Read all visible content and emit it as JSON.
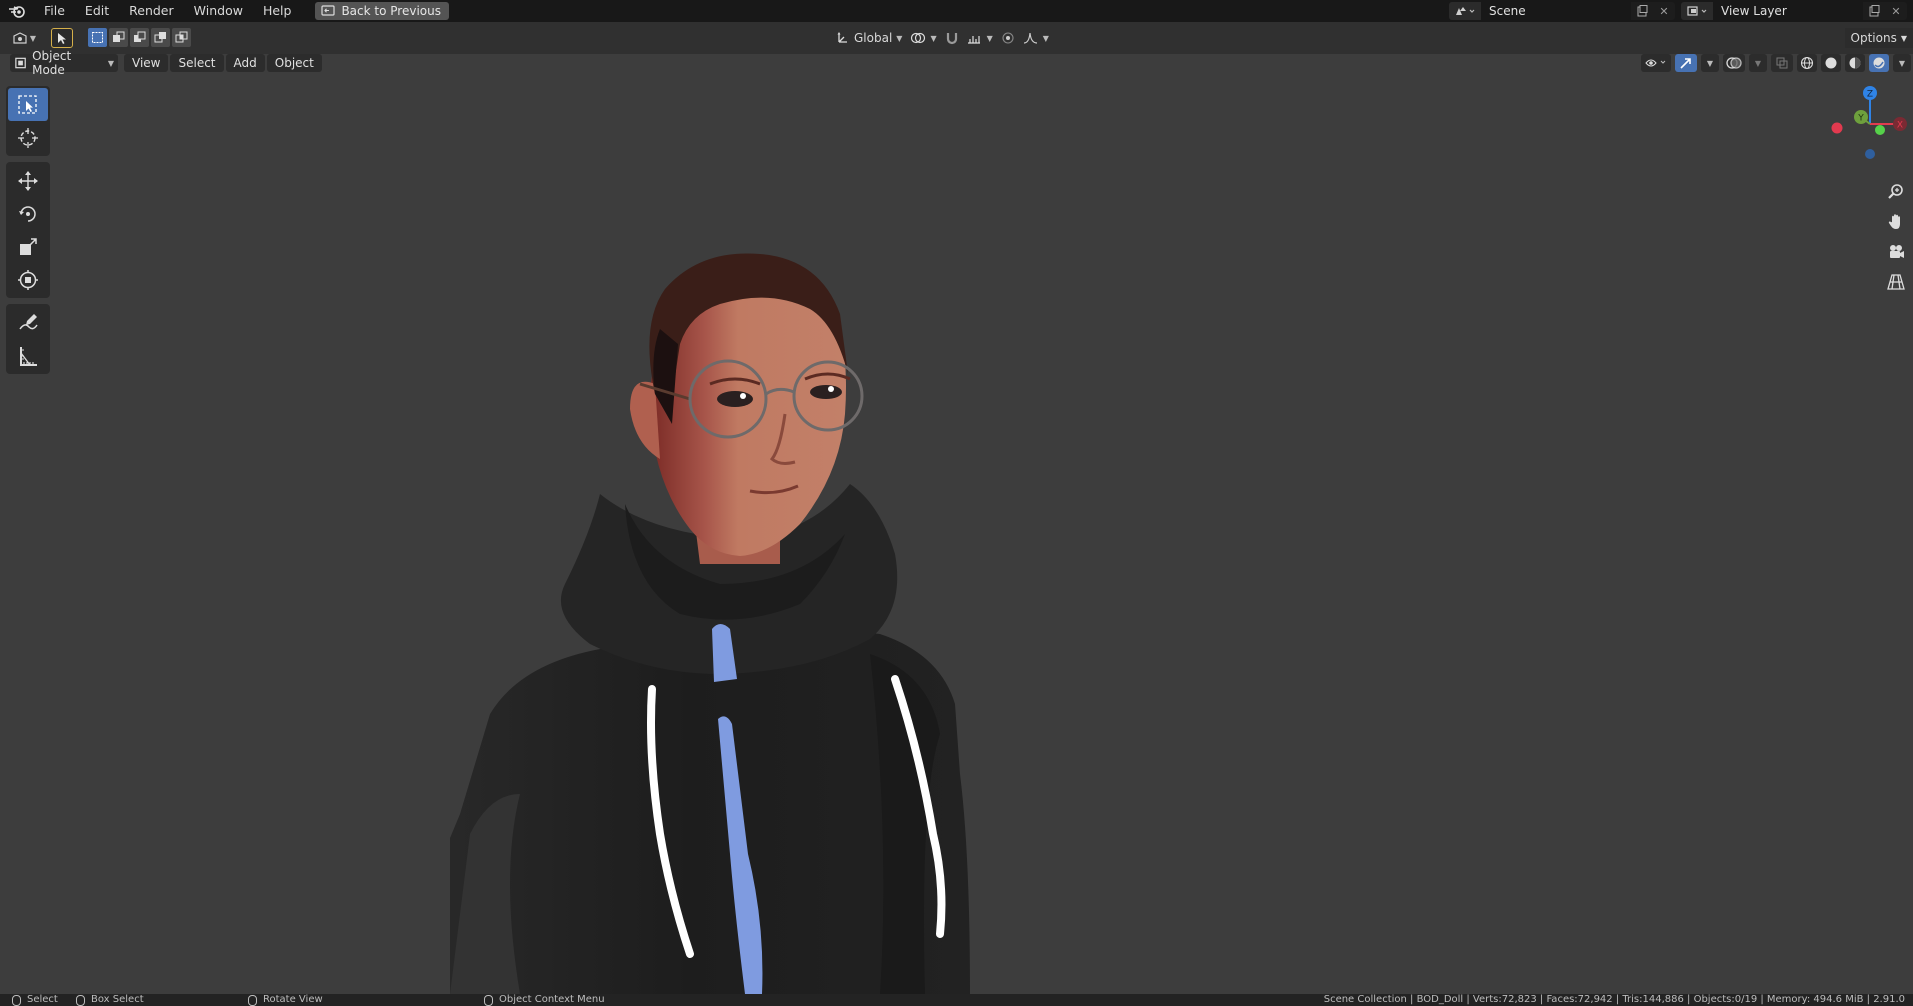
{
  "menu": {
    "items": [
      "File",
      "Edit",
      "Render",
      "Window",
      "Help"
    ],
    "back_button": "Back to Previous"
  },
  "workspace": {
    "scene": "Scene",
    "view_layer": "View Layer"
  },
  "tool_header": {
    "transform_orientation": "Global",
    "options_label": "Options"
  },
  "viewport_header": {
    "mode": "Object Mode",
    "menus": [
      "View",
      "Select",
      "Add",
      "Object"
    ]
  },
  "gizmo": {
    "z_label": "Z",
    "y_label": "Y",
    "x_label": "X",
    "z_color": "#2f83e6",
    "y_color": "#6ea03d",
    "x_color": "#e23a4f"
  },
  "toolbar": {
    "tools": [
      "select-box",
      "cursor",
      "move",
      "rotate",
      "scale",
      "transform",
      "annotate",
      "measure"
    ],
    "active_tool": "select-box"
  },
  "status_bar": {
    "select": "Select",
    "box_select": "Box Select",
    "rotate_view": "Rotate View",
    "context_menu": "Object Context Menu",
    "stats": "Scene Collection | BOD_Doll | Verts:72,823 | Faces:72,942 | Tris:144,886 | Objects:0/19 | Memory: 494.6 MiB | 2.91.0"
  },
  "colors": {
    "accent": "#4772b3",
    "hoodie": "#222222",
    "skin": "#c07a62",
    "hair": "#3a1e18",
    "drawstring": "#ffffff",
    "shirt_stripe": "#7f9be0"
  }
}
